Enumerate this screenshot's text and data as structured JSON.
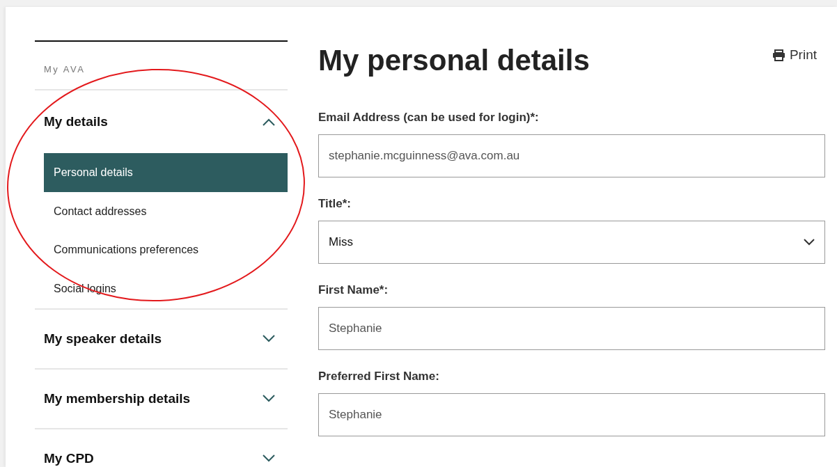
{
  "sidebar": {
    "heading": "My AVA",
    "sections": [
      {
        "title": "My details",
        "expanded": true,
        "items": [
          {
            "label": "Personal details",
            "selected": true
          },
          {
            "label": "Contact addresses",
            "selected": false
          },
          {
            "label": "Communications preferences",
            "selected": false
          },
          {
            "label": "Social logins",
            "selected": false
          }
        ]
      },
      {
        "title": "My speaker details",
        "expanded": false
      },
      {
        "title": "My membership details",
        "expanded": false
      },
      {
        "title": "My CPD",
        "expanded": false
      }
    ]
  },
  "page": {
    "title": "My personal details",
    "print_label": "Print",
    "fields": [
      {
        "kind": "text",
        "label": "Email Address (can be used for login)*:",
        "value": "stephanie.mcguinness@ava.com.au"
      },
      {
        "kind": "select",
        "label": "Title*:",
        "value": "Miss"
      },
      {
        "kind": "text",
        "label": "First Name*:",
        "value": "Stephanie"
      },
      {
        "kind": "text",
        "label": "Preferred First Name:",
        "value": "Stephanie"
      }
    ]
  }
}
